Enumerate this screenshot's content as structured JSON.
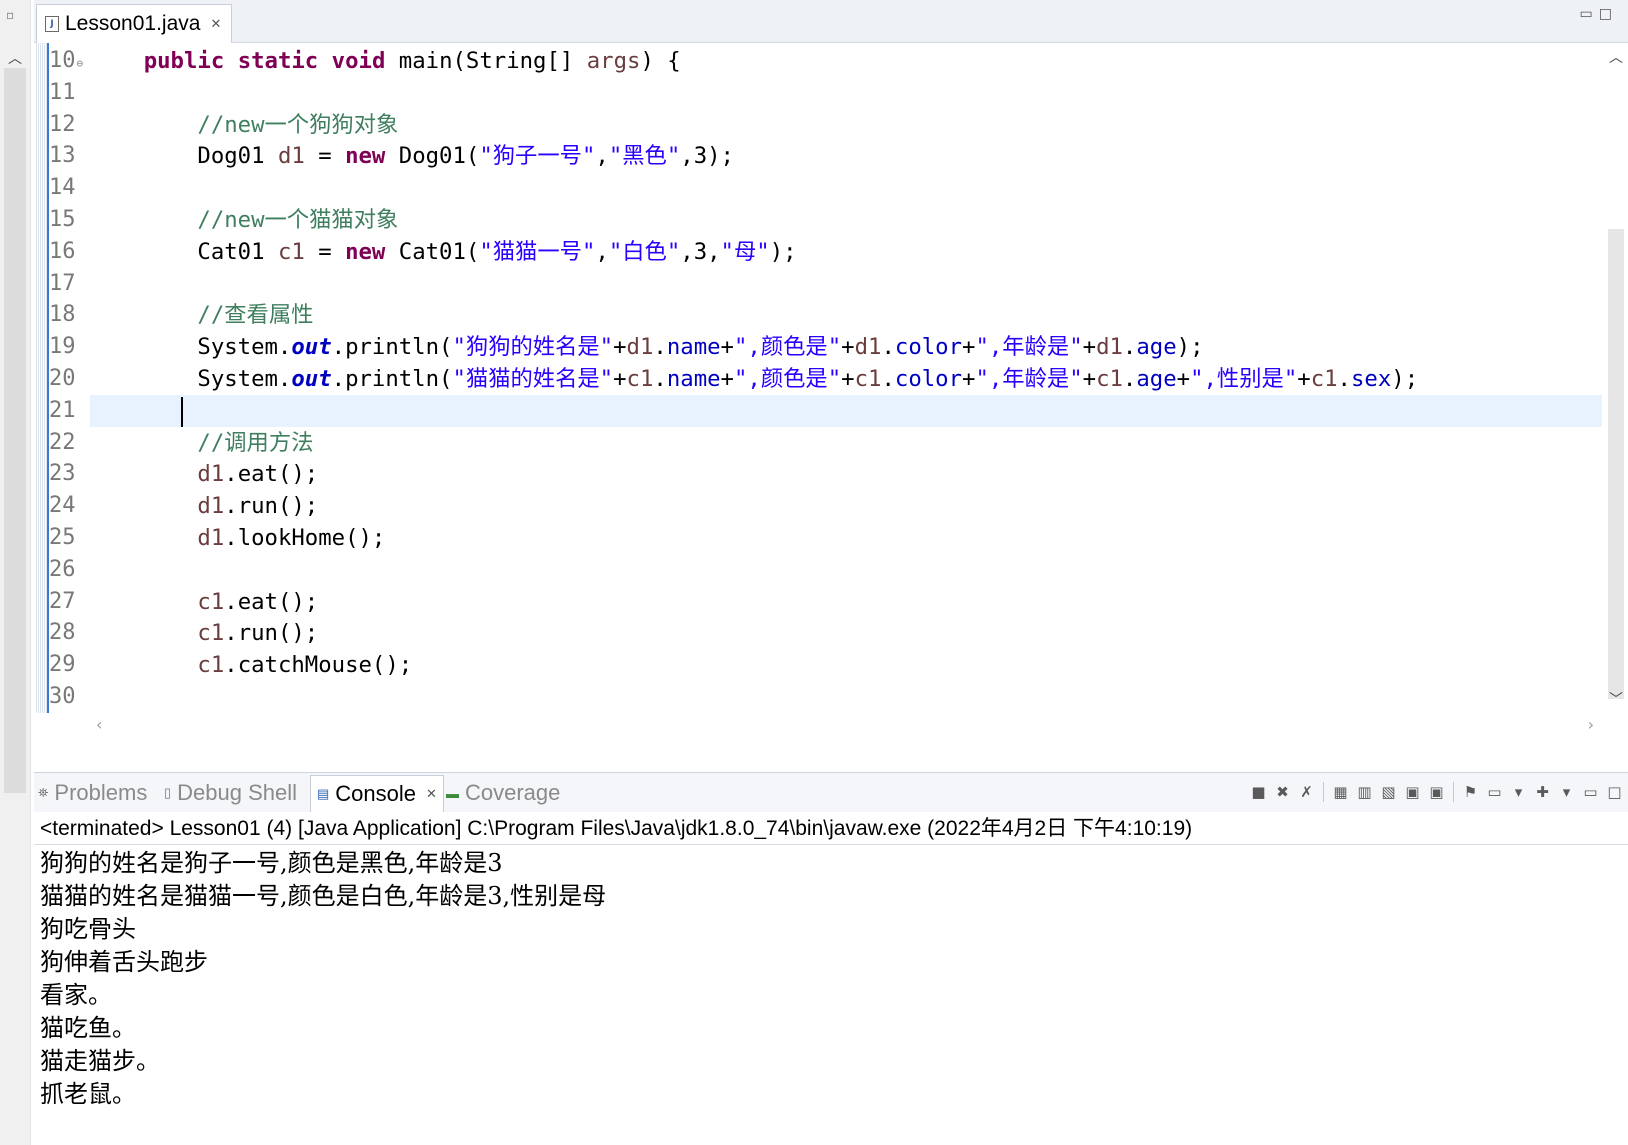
{
  "editor": {
    "tab_label": "Lesson01.java",
    "tab_close_symbol": "✕",
    "lines": [
      {
        "num": "10",
        "folded": true,
        "tokens": [
          {
            "t": "    ",
            "c": ""
          },
          {
            "t": "public",
            "c": "kw"
          },
          {
            "t": " ",
            "c": ""
          },
          {
            "t": "static",
            "c": "kw"
          },
          {
            "t": " ",
            "c": ""
          },
          {
            "t": "void",
            "c": "kw"
          },
          {
            "t": " main(String[] ",
            "c": ""
          },
          {
            "t": "args",
            "c": "lv"
          },
          {
            "t": ") {",
            "c": ""
          }
        ]
      },
      {
        "num": "11",
        "tokens": []
      },
      {
        "num": "12",
        "tokens": [
          {
            "t": "        ",
            "c": ""
          },
          {
            "t": "//new一个狗狗对象",
            "c": "cm"
          }
        ]
      },
      {
        "num": "13",
        "tokens": [
          {
            "t": "        Dog01 ",
            "c": ""
          },
          {
            "t": "d1",
            "c": "lv"
          },
          {
            "t": " = ",
            "c": ""
          },
          {
            "t": "new",
            "c": "kw"
          },
          {
            "t": " Dog01(",
            "c": ""
          },
          {
            "t": "\"狗子一号\"",
            "c": "str"
          },
          {
            "t": ",",
            "c": ""
          },
          {
            "t": "\"黑色\"",
            "c": "str"
          },
          {
            "t": ",3);",
            "c": ""
          }
        ]
      },
      {
        "num": "14",
        "tokens": []
      },
      {
        "num": "15",
        "tokens": [
          {
            "t": "        ",
            "c": ""
          },
          {
            "t": "//new一个猫猫对象",
            "c": "cm"
          }
        ]
      },
      {
        "num": "16",
        "tokens": [
          {
            "t": "        Cat01 ",
            "c": ""
          },
          {
            "t": "c1",
            "c": "lv"
          },
          {
            "t": " = ",
            "c": ""
          },
          {
            "t": "new",
            "c": "kw"
          },
          {
            "t": " Cat01(",
            "c": ""
          },
          {
            "t": "\"猫猫一号\"",
            "c": "str"
          },
          {
            "t": ",",
            "c": ""
          },
          {
            "t": "\"白色\"",
            "c": "str"
          },
          {
            "t": ",3,",
            "c": ""
          },
          {
            "t": "\"母\"",
            "c": "str"
          },
          {
            "t": ");",
            "c": ""
          }
        ]
      },
      {
        "num": "17",
        "tokens": []
      },
      {
        "num": "18",
        "tokens": [
          {
            "t": "        ",
            "c": ""
          },
          {
            "t": "//查看属性",
            "c": "cm"
          }
        ]
      },
      {
        "num": "19",
        "tokens": [
          {
            "t": "        System.",
            "c": ""
          },
          {
            "t": "out",
            "c": "sfld"
          },
          {
            "t": ".println(",
            "c": ""
          },
          {
            "t": "\"狗狗的姓名是\"",
            "c": "str"
          },
          {
            "t": "+",
            "c": ""
          },
          {
            "t": "d1",
            "c": "lv"
          },
          {
            "t": ".",
            "c": ""
          },
          {
            "t": "name",
            "c": "fld"
          },
          {
            "t": "+",
            "c": ""
          },
          {
            "t": "\",颜色是\"",
            "c": "str"
          },
          {
            "t": "+",
            "c": ""
          },
          {
            "t": "d1",
            "c": "lv"
          },
          {
            "t": ".",
            "c": ""
          },
          {
            "t": "color",
            "c": "fld"
          },
          {
            "t": "+",
            "c": ""
          },
          {
            "t": "\",年龄是\"",
            "c": "str"
          },
          {
            "t": "+",
            "c": ""
          },
          {
            "t": "d1",
            "c": "lv"
          },
          {
            "t": ".",
            "c": ""
          },
          {
            "t": "age",
            "c": "fld"
          },
          {
            "t": ");",
            "c": ""
          }
        ]
      },
      {
        "num": "20",
        "tokens": [
          {
            "t": "        System.",
            "c": ""
          },
          {
            "t": "out",
            "c": "sfld"
          },
          {
            "t": ".println(",
            "c": ""
          },
          {
            "t": "\"猫猫的姓名是\"",
            "c": "str"
          },
          {
            "t": "+",
            "c": ""
          },
          {
            "t": "c1",
            "c": "lv"
          },
          {
            "t": ".",
            "c": ""
          },
          {
            "t": "name",
            "c": "fld"
          },
          {
            "t": "+",
            "c": ""
          },
          {
            "t": "\",颜色是\"",
            "c": "str"
          },
          {
            "t": "+",
            "c": ""
          },
          {
            "t": "c1",
            "c": "lv"
          },
          {
            "t": ".",
            "c": ""
          },
          {
            "t": "color",
            "c": "fld"
          },
          {
            "t": "+",
            "c": ""
          },
          {
            "t": "\",年龄是\"",
            "c": "str"
          },
          {
            "t": "+",
            "c": ""
          },
          {
            "t": "c1",
            "c": "lv"
          },
          {
            "t": ".",
            "c": ""
          },
          {
            "t": "age",
            "c": "fld"
          },
          {
            "t": "+",
            "c": ""
          },
          {
            "t": "\",性别是\"",
            "c": "str"
          },
          {
            "t": "+",
            "c": ""
          },
          {
            "t": "c1",
            "c": "lv"
          },
          {
            "t": ".",
            "c": ""
          },
          {
            "t": "sex",
            "c": "fld"
          },
          {
            "t": ");",
            "c": ""
          }
        ]
      },
      {
        "num": "21",
        "tokens": []
      },
      {
        "num": "22",
        "tokens": [
          {
            "t": "        ",
            "c": ""
          },
          {
            "t": "//调用方法",
            "c": "cm"
          }
        ]
      },
      {
        "num": "23",
        "tokens": [
          {
            "t": "        ",
            "c": ""
          },
          {
            "t": "d1",
            "c": "lv"
          },
          {
            "t": ".eat();",
            "c": ""
          }
        ]
      },
      {
        "num": "24",
        "tokens": [
          {
            "t": "        ",
            "c": ""
          },
          {
            "t": "d1",
            "c": "lv"
          },
          {
            "t": ".run();",
            "c": ""
          }
        ]
      },
      {
        "num": "25",
        "tokens": [
          {
            "t": "        ",
            "c": ""
          },
          {
            "t": "d1",
            "c": "lv"
          },
          {
            "t": ".lookHome();",
            "c": ""
          }
        ]
      },
      {
        "num": "26",
        "tokens": []
      },
      {
        "num": "27",
        "tokens": [
          {
            "t": "        ",
            "c": ""
          },
          {
            "t": "c1",
            "c": "lv"
          },
          {
            "t": ".eat();",
            "c": ""
          }
        ]
      },
      {
        "num": "28",
        "tokens": [
          {
            "t": "        ",
            "c": ""
          },
          {
            "t": "c1",
            "c": "lv"
          },
          {
            "t": ".run();",
            "c": ""
          }
        ]
      },
      {
        "num": "29",
        "tokens": [
          {
            "t": "        ",
            "c": ""
          },
          {
            "t": "c1",
            "c": "lv"
          },
          {
            "t": ".catchMouse();",
            "c": ""
          }
        ]
      },
      {
        "num": "30",
        "tokens": []
      }
    ]
  },
  "bottom_panel": {
    "tabs": [
      {
        "label": "Problems",
        "icon": "problems-icon",
        "active": false
      },
      {
        "label": "Debug Shell",
        "icon": "debug-shell-icon",
        "active": false
      },
      {
        "label": "Console",
        "icon": "console-icon",
        "active": true
      },
      {
        "label": "Coverage",
        "icon": "coverage-icon",
        "active": false
      }
    ],
    "console_header": "<terminated> Lesson01 (4) [Java Application] C:\\Program Files\\Java\\jdk1.8.0_74\\bin\\javaw.exe (2022年4月2日 下午4:10:19)",
    "output_lines": [
      "狗狗的姓名是狗子一号,颜色是黑色,年龄是3",
      "猫猫的姓名是猫猫一号,颜色是白色,年龄是3,性别是母",
      "狗吃骨头",
      "狗伸着舌头跑步",
      "看家。",
      "猫吃鱼。",
      "猫走猫步。",
      "抓老鼠。"
    ]
  },
  "colors": {
    "keyword": "#7f0055",
    "comment": "#3f7f5f",
    "string": "#2a00ff",
    "field": "#0000c0",
    "local_variable": "#6a3e3e",
    "current_line": "#e8f2fe"
  }
}
